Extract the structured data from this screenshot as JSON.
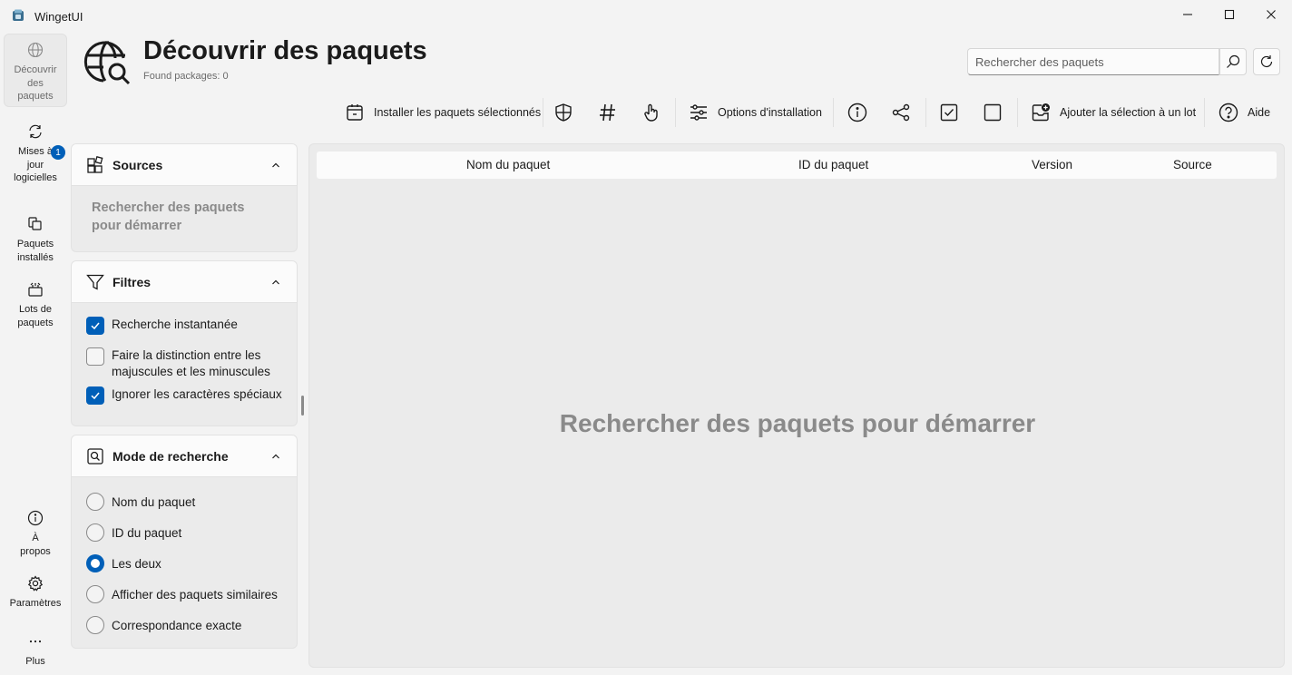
{
  "window": {
    "title": "WingetUI"
  },
  "nav": {
    "items": [
      {
        "label": "Découvrir des paquets",
        "icon": "globe-icon",
        "active": true
      },
      {
        "label": "Mises à jour logicielles",
        "icon": "sync-icon",
        "badge": "1"
      },
      {
        "label": "Paquets installés",
        "icon": "installed-icon"
      },
      {
        "label": "Lots de paquets",
        "icon": "bundle-icon"
      },
      {
        "label": "À propos",
        "icon": "info-icon"
      },
      {
        "label": "Paramètres",
        "icon": "gear-icon"
      },
      {
        "label": "Plus",
        "icon": "more-icon"
      }
    ]
  },
  "header": {
    "title": "Découvrir des paquets",
    "subtitle": "Found packages: 0",
    "search_placeholder": "Rechercher des paquets"
  },
  "toolbar": {
    "install_label": "Installer les paquets sélectionnés",
    "options_label": "Options d'installation",
    "add_bundle_label": "Ajouter la sélection à un lot",
    "help_label": "Aide"
  },
  "sources": {
    "title": "Sources",
    "empty_text": "Rechercher des paquets pour démarrer"
  },
  "filters": {
    "title": "Filtres",
    "options": [
      {
        "label": "Recherche instantanée",
        "checked": true
      },
      {
        "label": "Faire la distinction entre les majuscules et les minuscules",
        "checked": false
      },
      {
        "label": "Ignorer les caractères spéciaux",
        "checked": true
      }
    ]
  },
  "search_mode": {
    "title": "Mode de recherche",
    "options": [
      {
        "label": "Nom du paquet",
        "selected": false
      },
      {
        "label": "ID du paquet",
        "selected": false
      },
      {
        "label": "Les deux",
        "selected": true
      },
      {
        "label": "Afficher des paquets similaires",
        "selected": false
      },
      {
        "label": "Correspondance exacte",
        "selected": false
      }
    ]
  },
  "table": {
    "columns": [
      "Nom du paquet",
      "ID du paquet",
      "Version",
      "Source"
    ],
    "empty_text": "Rechercher des paquets pour démarrer"
  },
  "colors": {
    "accent": "#005fb8",
    "background": "#f3f3f3",
    "panel": "#ebebeb"
  }
}
